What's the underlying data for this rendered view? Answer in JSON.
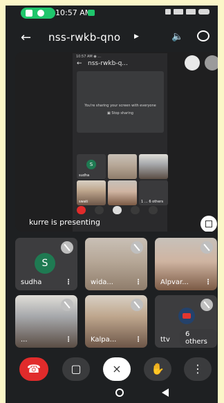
{
  "status_bar": {
    "time": "10:57 AM"
  },
  "header": {
    "meeting_code": "nss-rwkb-qno"
  },
  "shared_screen": {
    "mirror_time": "10:57 AM ◉ ...",
    "mirror_title": "nss-rwkb-q...",
    "sharing_message": "You're sharing your screen with everyone",
    "stop_sharing_label": "Stop sharing",
    "tiles": [
      {
        "label": "sudha",
        "avatar": "S"
      },
      {
        "label": ""
      },
      {
        "label": ""
      },
      {
        "label": "swati"
      },
      {
        "label": ""
      },
      {
        "label": "1 … 6 others"
      }
    ]
  },
  "presenter_banner": "kurre is presenting",
  "participants": [
    {
      "name": "sudha",
      "avatar": "S"
    },
    {
      "name": "wida..."
    },
    {
      "name": "Alpvar..."
    },
    {
      "name": "..."
    },
    {
      "name": "Kalpa..."
    },
    {
      "name": "ttv",
      "others": "6 others"
    }
  ],
  "colors": {
    "end_call": "#e12b2b",
    "avatar": "#1f7a52",
    "call_pill": "#1fc66c",
    "background": "#1e2022"
  },
  "icons": [
    "back-arrow-icon",
    "volume-icon",
    "flip-camera-icon",
    "pin-icon",
    "mic-off-icon",
    "fullscreen-icon",
    "end-call-icon",
    "camera-icon",
    "raise-hand-icon",
    "more-icon",
    "home-icon",
    "back-icon"
  ]
}
